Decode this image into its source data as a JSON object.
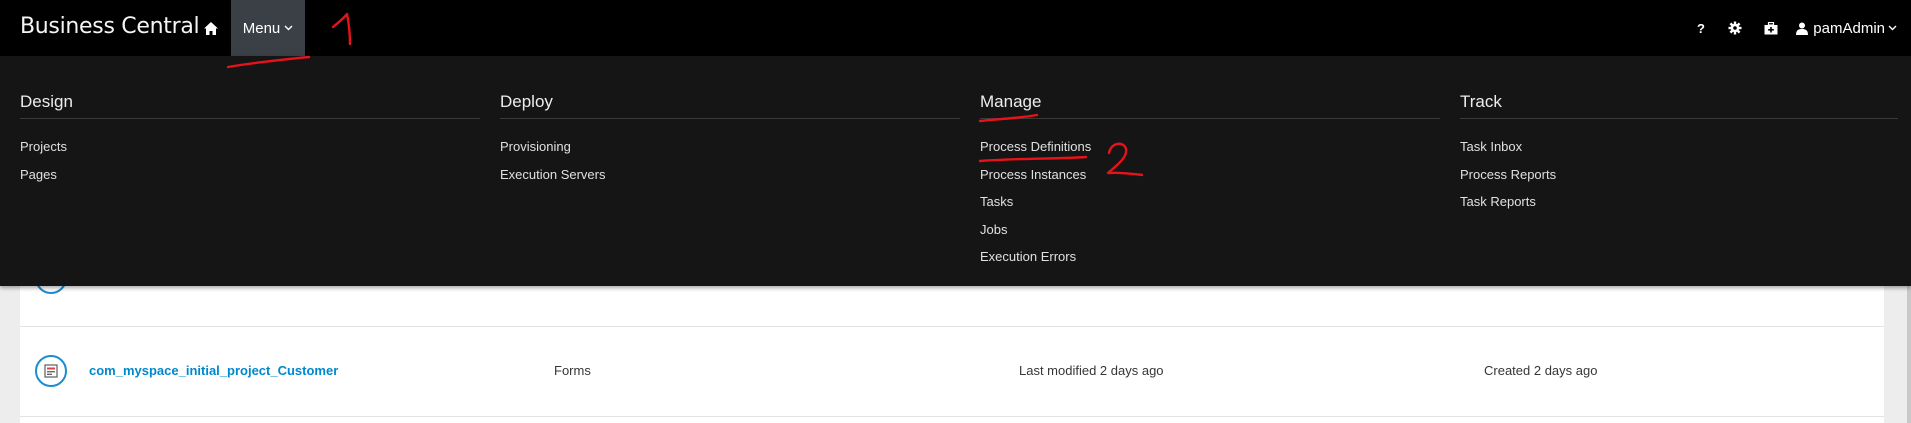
{
  "header": {
    "brand": "Business Central",
    "menu_label": "Menu",
    "user_name": "pamAdmin",
    "icons": [
      "home-icon",
      "help-icon",
      "gear-icon",
      "first-aid-icon",
      "user-icon"
    ]
  },
  "mega_menu": {
    "design": {
      "title": "Design",
      "items": [
        "Projects",
        "Pages"
      ]
    },
    "deploy": {
      "title": "Deploy",
      "items": [
        "Provisioning",
        "Execution Servers"
      ]
    },
    "manage": {
      "title": "Manage",
      "items": [
        "Process Definitions",
        "Process Instances",
        "Tasks",
        "Jobs",
        "Execution Errors"
      ]
    },
    "track": {
      "title": "Track",
      "items": [
        "Task Inbox",
        "Process Reports",
        "Task Reports"
      ]
    }
  },
  "assets": {
    "rows": [
      {
        "name": "com_myspace_initial_project_Customer",
        "type": "Forms",
        "modified": "Last modified 2 days ago",
        "created": "Created 2 days ago"
      }
    ]
  },
  "annotations": {
    "mark1": "1",
    "mark2": "2",
    "color": "#e8121b"
  },
  "colors": {
    "topbar": "#000000",
    "menu_active": "#3b4046",
    "mega_bg": "#151515",
    "link": "#0088ce"
  }
}
